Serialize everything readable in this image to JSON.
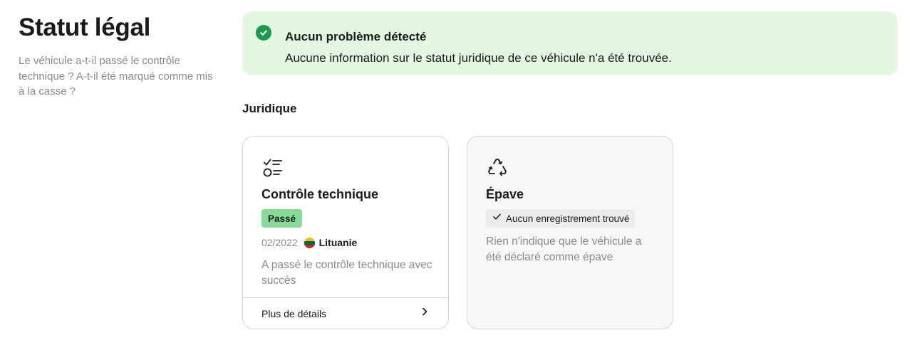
{
  "header": {
    "title": "Statut légal",
    "description": "Le véhicule a-t-il passé le contrôle technique ? A-t-il été marqué comme mis à la casse ?"
  },
  "alert": {
    "icon": "check-circle-icon",
    "color": "#1f9a4c",
    "background": "#e3f7e3",
    "title": "Aucun problème détecté",
    "text": "Aucune information sur le statut juridique de ce véhicule n'a été trouvée."
  },
  "section": {
    "title": "Juridique"
  },
  "cards": {
    "inspection": {
      "icon": "checklist-icon",
      "title": "Contrôle technique",
      "badge": "Passé",
      "badge_color": "#86dc97",
      "date": "02/2022",
      "flag_icon": "lithuania-flag-icon",
      "country": "Lituanie",
      "description": "A passé le contrôle technique avec succès",
      "footer_label": "Plus de détails",
      "footer_icon": "chevron-right-icon"
    },
    "wreck": {
      "icon": "recycle-icon",
      "title": "Épave",
      "badge_icon": "check-icon",
      "badge": "Aucun enregistrement trouvé",
      "description": "Rien n'indique que le véhicule a été déclaré comme épave"
    }
  }
}
